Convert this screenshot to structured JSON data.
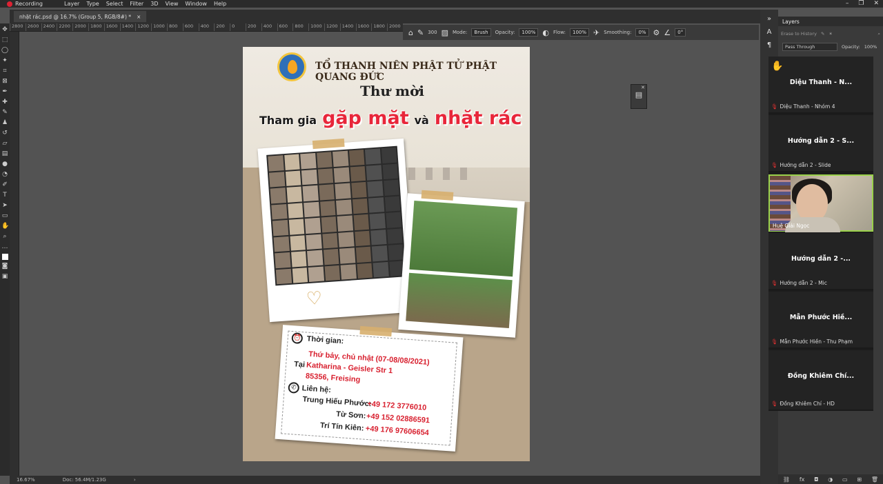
{
  "menubar": {
    "recording": "Recording",
    "items": [
      "Layer",
      "Type",
      "Select",
      "Filter",
      "3D",
      "View",
      "Window",
      "Help"
    ]
  },
  "doc_tab": {
    "title": "nhặt rác.psd @ 16.7% (Group 5, RGB/8#) *",
    "close": "×"
  },
  "ruler": [
    "2800",
    "2600",
    "2400",
    "2200",
    "2000",
    "1800",
    "1600",
    "1400",
    "1200",
    "1000",
    "800",
    "600",
    "400",
    "200",
    "0",
    "200",
    "400",
    "600",
    "800",
    "1000",
    "1200",
    "1400",
    "1600",
    "1800",
    "2000"
  ],
  "options": {
    "mode_label": "Mode:",
    "mode_value": "Brush",
    "opacity_label": "Opacity:",
    "opacity_value": "100%",
    "flow_label": "Flow:",
    "flow_value": "100%",
    "smoothing_label": "Smoothing:",
    "smoothing_value": "0%",
    "angle_value": "0°",
    "brush_size": "300"
  },
  "layers": {
    "title": "Layers",
    "erase_label": "Erase to History",
    "blend_mode": "Pass Through",
    "opacity_label": "Opacity:",
    "opacity_value": "100%"
  },
  "status": {
    "zoom": "16.67%",
    "doc": "Doc: 56.4M/1.23G",
    "arrow": "›"
  },
  "poster": {
    "org": "TỔ THANH NIÊN PHẬT TỬ PHẬT QUANG ĐỨC",
    "invite": "Thư mời",
    "line_a": "Tham gia",
    "line_b": "gặp mặt",
    "line_c": "và",
    "line_d": "nhặt rác",
    "time_label": "Thời gian:",
    "time_value": "Thứ bảy, chủ nhật (07-08/08/2021)",
    "at_label": "Tại",
    "address1": "Katharina - Geisler Str 1",
    "address2": "85356, Freising",
    "contact_label": "Liên hệ:",
    "contacts": [
      {
        "name": "Trung Hiếu Phước:",
        "phone": "+49 172 3776010"
      },
      {
        "name": "Từ Sơn:",
        "phone": "+49 152 02886591"
      },
      {
        "name": "Trí Tín Kiên:",
        "phone": "+49 176 97606654"
      }
    ]
  },
  "call": {
    "participants": [
      {
        "big": "Diệu Thanh - N...",
        "small": "Diệu Thanh - Nhóm 4"
      },
      {
        "big": "Hướng dẫn 2 - S...",
        "small": "Hướng dẫn 2 - Slide"
      },
      {
        "video_name": "Huệ Giải Ngọc"
      },
      {
        "big": "Hướng dẫn 2 -...",
        "small": "Hướng dẫn 2 - Mic"
      },
      {
        "big": "Mẫn Phước Hiề...",
        "small": "Mẫn Phước Hiền - Thu Phạm"
      },
      {
        "big": "Đồng Khiêm Chí...",
        "small": "Đồng Khiêm Chí - HD"
      }
    ]
  },
  "colors": {
    "accent_red": "#e8263a",
    "call_highlight": "#9ad14a"
  }
}
